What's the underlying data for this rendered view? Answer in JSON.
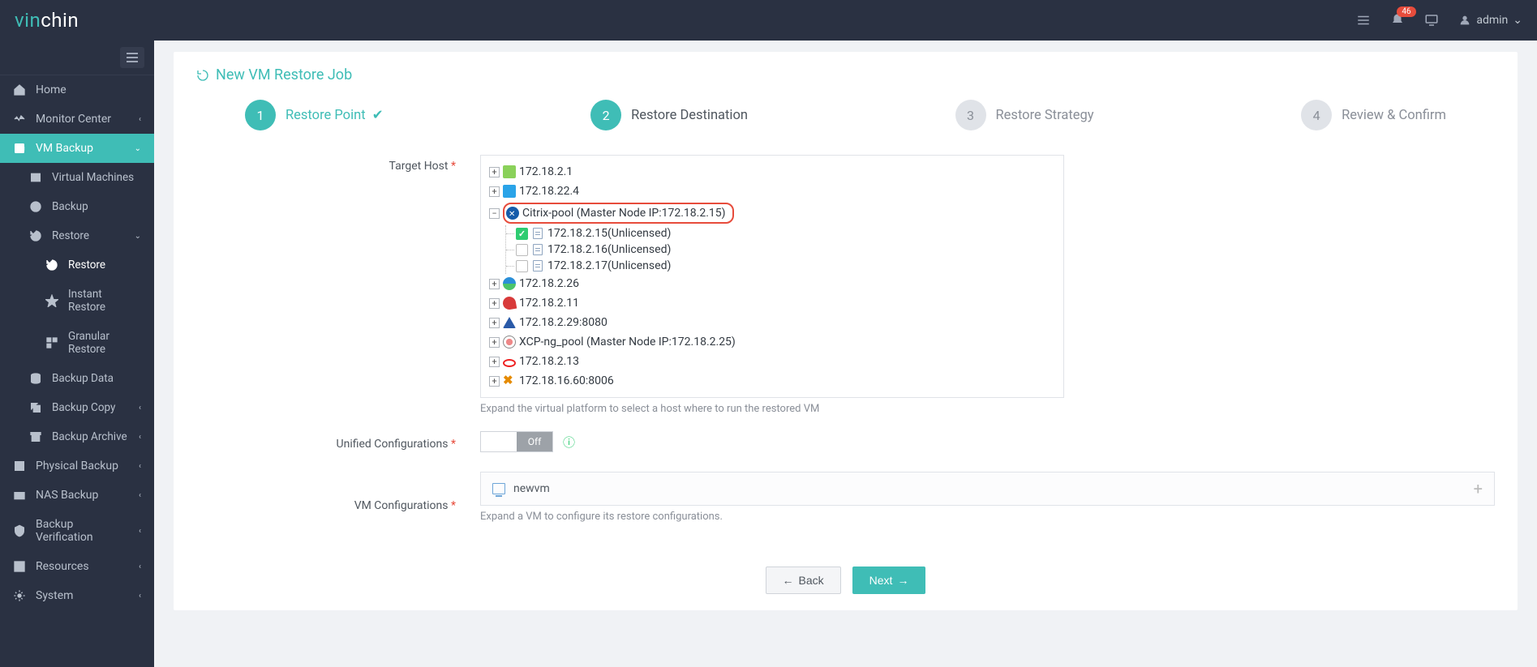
{
  "header": {
    "logo_part1": "vin",
    "logo_part2": "chin",
    "badge": "46",
    "user": "admin"
  },
  "sidebar": {
    "items": [
      {
        "label": "Home"
      },
      {
        "label": "Monitor Center"
      },
      {
        "label": "VM Backup",
        "children": [
          {
            "label": "Virtual Machines"
          },
          {
            "label": "Backup"
          },
          {
            "label": "Restore",
            "children": [
              {
                "label": "Restore"
              },
              {
                "label": "Instant Restore"
              },
              {
                "label": "Granular Restore"
              }
            ]
          },
          {
            "label": "Backup Data"
          },
          {
            "label": "Backup Copy"
          },
          {
            "label": "Backup Archive"
          }
        ]
      },
      {
        "label": "Physical Backup"
      },
      {
        "label": "NAS Backup"
      },
      {
        "label": "Backup Verification"
      },
      {
        "label": "Resources"
      },
      {
        "label": "System"
      }
    ]
  },
  "page": {
    "title": "New VM Restore Job",
    "steps": [
      {
        "num": "1",
        "label": "Restore Point"
      },
      {
        "num": "2",
        "label": "Restore Destination"
      },
      {
        "num": "3",
        "label": "Restore Strategy"
      },
      {
        "num": "4",
        "label": "Review & Confirm"
      }
    ],
    "labels": {
      "target_host": "Target Host",
      "unified": "Unified Configurations",
      "vm_config": "VM Configurations",
      "toggle_off": "Off"
    },
    "tree": [
      {
        "label": "172.18.2.1"
      },
      {
        "label": "172.18.22.4"
      },
      {
        "label": "Citrix-pool (Master Node IP:172.18.2.15)",
        "highlighted": true,
        "expanded": true,
        "children": [
          {
            "label": "172.18.2.15(Unlicensed)",
            "checked": true
          },
          {
            "label": "172.18.2.16(Unlicensed)",
            "checked": false
          },
          {
            "label": "172.18.2.17(Unlicensed)",
            "checked": false
          }
        ]
      },
      {
        "label": "172.18.2.26"
      },
      {
        "label": "172.18.2.11"
      },
      {
        "label": "172.18.2.29:8080"
      },
      {
        "label": "XCP-ng_pool (Master Node IP:172.18.2.25)"
      },
      {
        "label": "172.18.2.13"
      },
      {
        "label": "172.18.16.60:8006"
      }
    ],
    "help": {
      "tree": "Expand the virtual platform to select a host where to run the restored VM",
      "vm": "Expand a VM to configure its restore configurations."
    },
    "vm_name": "newvm",
    "buttons": {
      "back": "Back",
      "next": "Next"
    }
  }
}
